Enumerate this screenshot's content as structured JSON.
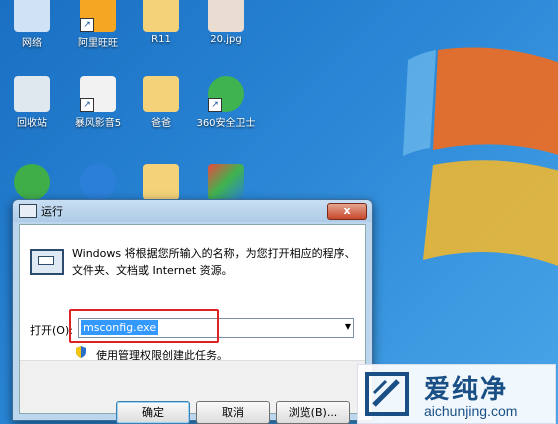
{
  "desktop_icons": [
    {
      "label": "网络"
    },
    {
      "label": "阿里旺旺"
    },
    {
      "label": "R11"
    },
    {
      "label": "20.jpg"
    },
    {
      "label": "回收站"
    },
    {
      "label": "暴风影音5"
    },
    {
      "label": "爸爸"
    },
    {
      "label": "360安全卫士"
    }
  ],
  "dialog": {
    "title": "运行",
    "close_label": "x",
    "description": "Windows 将根据您所输入的名称，为您打开相应的程序、文件夹、文档或 Internet 资源。",
    "open_label": "打开(O):",
    "open_value": "msconfig.exe",
    "admin_text": "使用管理权限创建此任务。",
    "ok_label": "确定",
    "cancel_label": "取消",
    "browse_label": "浏览(B)..."
  },
  "watermark": {
    "name": "爱纯净",
    "url": "aichunjing.com"
  },
  "colors": {
    "highlight_box": "#dd2222",
    "selection": "#3399ff",
    "desktop": "#2a86d6"
  }
}
